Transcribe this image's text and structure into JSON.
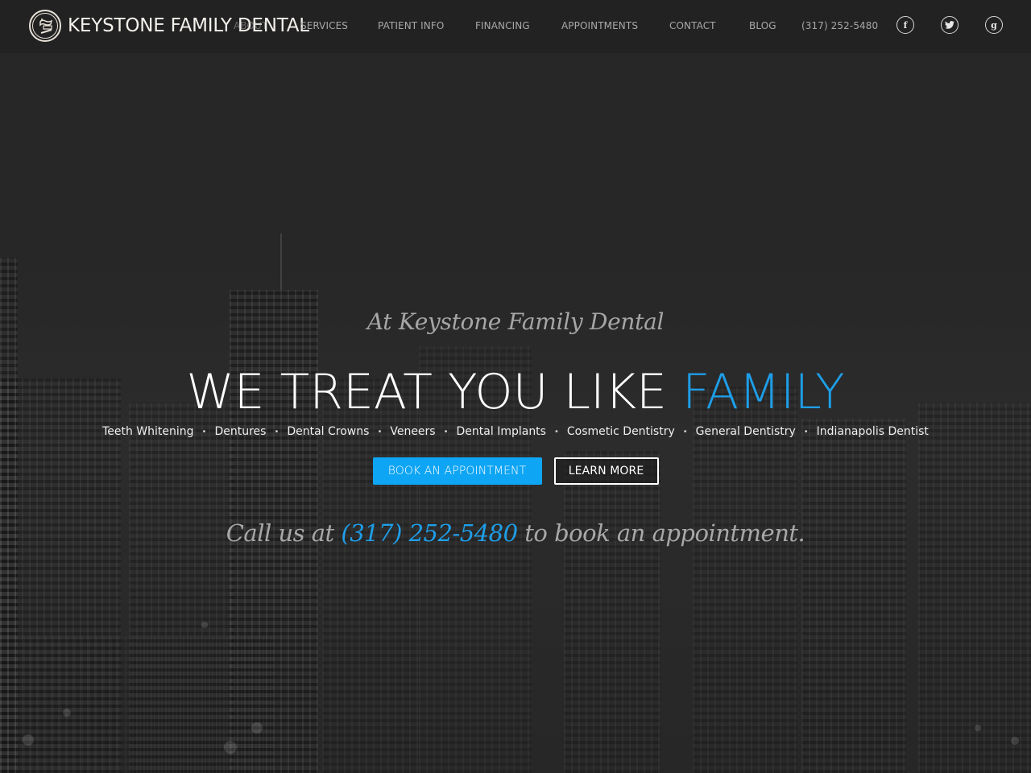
{
  "brand": {
    "name": "KEYSTONE FAMILY DENTAL",
    "logo_icon": "tooth-toothbrush-emblem-icon"
  },
  "nav": {
    "items": [
      {
        "label": "ABOUT"
      },
      {
        "label": "SERVICES"
      },
      {
        "label": "PATIENT INFO"
      },
      {
        "label": "FINANCING"
      },
      {
        "label": "APPOINTMENTS"
      },
      {
        "label": "CONTACT"
      },
      {
        "label": "BLOG"
      }
    ],
    "phone": "(317) 252-5480",
    "social": [
      {
        "name": "facebook",
        "icon": "facebook-icon",
        "glyph": "f"
      },
      {
        "name": "twitter",
        "icon": "twitter-icon",
        "glyph": "🐦"
      },
      {
        "name": "google-plus",
        "icon": "google-plus-icon",
        "glyph": "g"
      }
    ]
  },
  "hero": {
    "intro": "At Keystone Family Dental",
    "title_plain": "WE TREAT YOU LIKE ",
    "title_accent": "FAMILY",
    "services": [
      "Teeth Whitening",
      "Dentures",
      "Dental Crowns",
      "Veneers",
      "Dental Implants",
      "Cosmetic Dentistry",
      "General Dentistry",
      "Indianapolis Dentist"
    ],
    "separator": "•",
    "primary_button": "BOOK AN APPOINTMENT",
    "secondary_button": "LEARN MORE",
    "callout_before": "Call us at ",
    "callout_phone": "(317) 252-5480",
    "callout_after": " to book an appointment."
  },
  "colors": {
    "accent": "#1e9ee8",
    "button_primary": "#0ea5f4",
    "header_bg": "#222222",
    "page_bg": "#272727"
  }
}
